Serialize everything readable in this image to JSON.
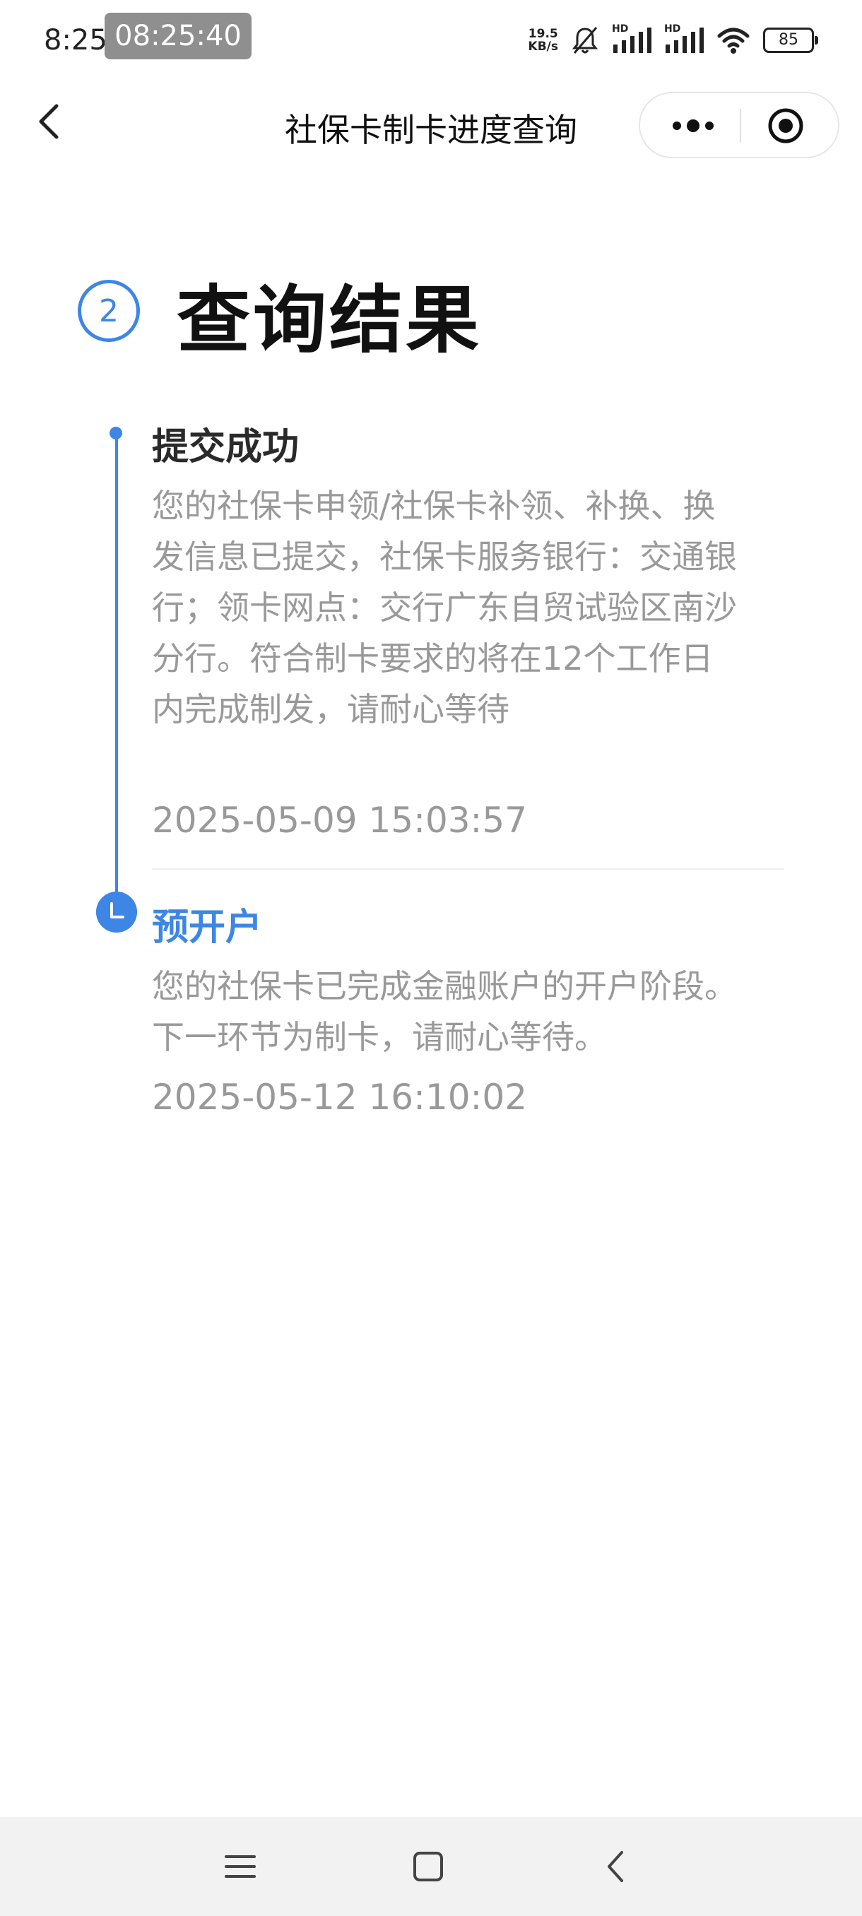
{
  "status_bar": {
    "time": "8:25",
    "overlay_time": "08:25:40",
    "net_speed_value": "19.5",
    "net_speed_unit": "KB/s",
    "signal1_label": "HD",
    "signal2_label": "HD",
    "battery": "85"
  },
  "nav": {
    "title": "社保卡制卡进度查询"
  },
  "step": {
    "number": "2",
    "title": "查询结果"
  },
  "timeline": [
    {
      "title": "提交成功",
      "description": "您的社保卡申领/社保卡补领、补换、换发信息已提交，社保卡服务银行：交通银行；领卡网点：交行广东自贸试验区南沙分行。符合制卡要求的将在12个工作日内完成制发，请耐心等待",
      "time": "2025-05-09 15:03:57"
    },
    {
      "title": "预开户",
      "description": "您的社保卡已完成金融账户的开户阶段。下一环节为制卡，请耐心等待。",
      "time": "2025-05-12 16:10:02"
    }
  ],
  "colors": {
    "accent": "#3d86e6",
    "muted_text": "#999999",
    "title_text": "#111111"
  }
}
